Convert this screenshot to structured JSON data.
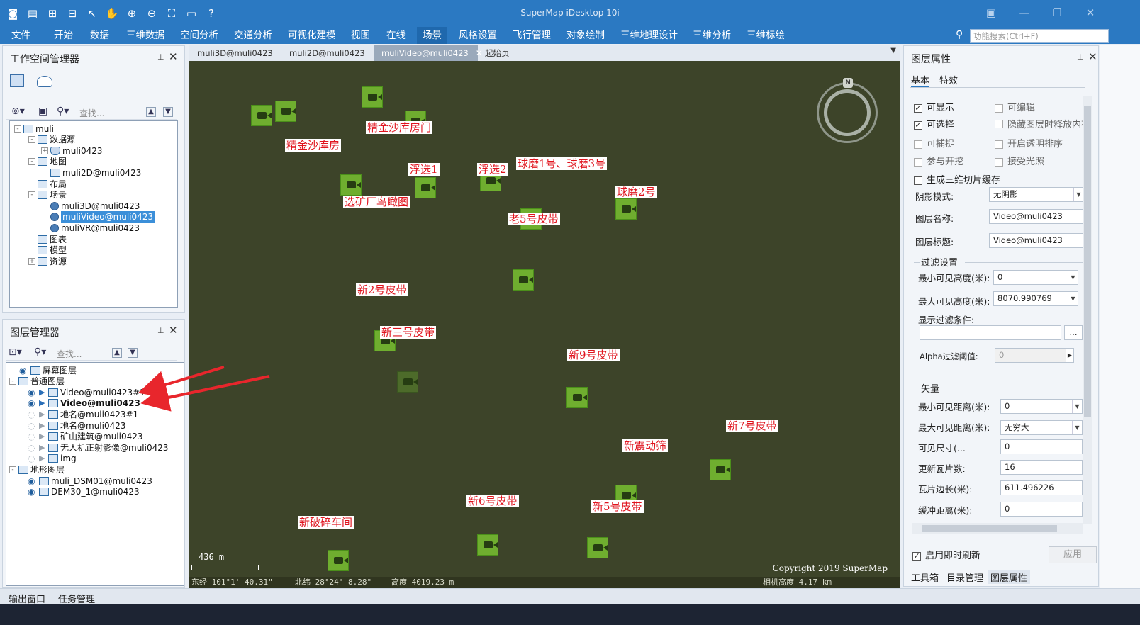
{
  "app": {
    "title": "SuperMap iDesktop 10i",
    "quick_access_icons": [
      "app-logo-icon",
      "save-icon",
      "new-icon",
      "open-icon",
      "select-icon",
      "pan-icon",
      "zoom-in-icon",
      "zoom-out-icon",
      "full-extent-icon",
      "folder-icon",
      "help-icon"
    ],
    "window_buttons": [
      "restore-icon",
      "minimize-icon",
      "maximize-icon",
      "close-icon"
    ]
  },
  "menu": {
    "items": [
      "文件",
      "开始",
      "数据",
      "三维数据",
      "空间分析",
      "交通分析",
      "可视化建模",
      "视图",
      "在线",
      "场景",
      "风格设置",
      "飞行管理",
      "对象绘制",
      "三维地理设计",
      "三维分析",
      "三维标绘"
    ],
    "active": "场景",
    "search_placeholder": "功能搜索(Ctrl+F)"
  },
  "workspace": {
    "title": "工作空间管理器",
    "search_placeholder": "查找...",
    "tree": [
      {
        "label": "muli",
        "icon": "workspace-icon",
        "exp": "-"
      },
      {
        "label": "数据源",
        "icon": "datasource-folder-icon",
        "exp": "-"
      },
      {
        "label": "muli0423",
        "icon": "datasource-icon",
        "exp": "+"
      },
      {
        "label": "地图",
        "icon": "map-folder-icon",
        "exp": "-"
      },
      {
        "label": "muli2D@muli0423",
        "icon": "map-icon",
        "exp": ""
      },
      {
        "label": "布局",
        "icon": "layout-icon",
        "exp": ""
      },
      {
        "label": "场景",
        "icon": "scene-folder-icon",
        "exp": "-"
      },
      {
        "label": "muli3D@muli0423",
        "icon": "scene-icon",
        "exp": ""
      },
      {
        "label": "muliVideo@muli0423",
        "icon": "scene-icon",
        "exp": "",
        "selected": true
      },
      {
        "label": "muliVR@muli0423",
        "icon": "scene-icon",
        "exp": ""
      },
      {
        "label": "图表",
        "icon": "chart-icon",
        "exp": ""
      },
      {
        "label": "模型",
        "icon": "model-icon",
        "exp": ""
      },
      {
        "label": "资源",
        "icon": "resource-icon",
        "exp": "+"
      }
    ]
  },
  "layers": {
    "title": "图层管理器",
    "search_placeholder": "查找...",
    "tree": [
      {
        "label": "屏幕图层",
        "visible": true,
        "exp": ""
      },
      {
        "label": "普通图层",
        "visible": null,
        "exp": "-"
      },
      {
        "label": "Video@muli0423#1",
        "visible": true,
        "exp": ""
      },
      {
        "label": "Video@muli0423",
        "visible": true,
        "exp": "",
        "bold": true
      },
      {
        "label": "地名@muli0423#1",
        "visible": false,
        "exp": ""
      },
      {
        "label": "地名@muli0423",
        "visible": false,
        "exp": ""
      },
      {
        "label": "矿山建筑@muli0423",
        "visible": false,
        "exp": ""
      },
      {
        "label": "无人机正射影像@muli0423",
        "visible": false,
        "exp": ""
      },
      {
        "label": "img",
        "visible": false,
        "exp": ""
      },
      {
        "label": "地形图层",
        "visible": null,
        "exp": "-"
      },
      {
        "label": "muli_DSM01@muli0423",
        "visible": true,
        "exp": ""
      },
      {
        "label": "DEM30_1@muli0423",
        "visible": true,
        "exp": ""
      }
    ]
  },
  "doc_tabs": {
    "tabs": [
      "muli3D@muli0423",
      "muli2D@muli0423",
      "muliVideo@muli0423",
      "起始页"
    ],
    "active": "muliVideo@muli0423"
  },
  "map": {
    "labels": [
      "精金沙库房",
      "精金沙库房门",
      "浮选1",
      "浮选2",
      "球磨1号、球磨3号",
      "球磨2号",
      "选矿厂鸟瞰图",
      "老5号皮带",
      "新2号皮带",
      "新三号皮带",
      "新9号皮带",
      "新7号皮带",
      "新震动筛",
      "新6号皮带",
      "新5号皮带",
      "新破碎车间"
    ],
    "camera_count": 21,
    "compass_label": "N",
    "scale": "436 m",
    "copyright": "Copyright 2019 SuperMap",
    "status": {
      "lon": "东经 101°1' 40.31\"",
      "lat": "北纬 28°24' 8.28\"",
      "height": "高度 4019.23 m",
      "camera_height": "相机高度 4.17 km"
    },
    "colors": {
      "background": "#3d4429",
      "camera": "#6fae2f",
      "label_text": "#e0141e"
    }
  },
  "props": {
    "title": "图层属性",
    "tabs": [
      "基本",
      "特效"
    ],
    "checks": [
      {
        "label": "可显示",
        "checked": true,
        "enabled": true
      },
      {
        "label": "可编辑",
        "checked": false,
        "enabled": false
      },
      {
        "label": "可选择",
        "checked": true,
        "enabled": true
      },
      {
        "label": "隐藏图层时释放内存",
        "checked": false,
        "enabled": false
      },
      {
        "label": "可捕捉",
        "checked": false,
        "enabled": false
      },
      {
        "label": "开启透明排序",
        "checked": false,
        "enabled": false
      },
      {
        "label": "参与开挖",
        "checked": false,
        "enabled": false
      },
      {
        "label": "接受光照",
        "checked": false,
        "enabled": false
      },
      {
        "label": "生成三维切片缓存",
        "checked": false,
        "enabled": true
      }
    ],
    "shadow_mode_label": "阴影模式:",
    "shadow_mode_value": "无阴影",
    "layer_name_label": "图层名称:",
    "layer_name_value": "Video@muli0423",
    "layer_caption_label": "图层标题:",
    "layer_caption_value": "Video@muli0423",
    "filter_group": "过滤设置",
    "min_height_label": "最小可见高度(米):",
    "min_height_value": "0",
    "max_height_label": "最大可见高度(米):",
    "max_height_value": "8070.990769",
    "filter_cond_label": "显示过滤条件:",
    "filter_cond_btn": "...",
    "alpha_label": "Alpha过滤阈值:",
    "alpha_value": "0",
    "vector_group": "矢量",
    "min_dist_label": "最小可见距离(米):",
    "min_dist_value": "0",
    "max_dist_label": "最大可见距离(米):",
    "max_dist_value": "无穷大",
    "visible_size_label": "可见尺寸(...",
    "visible_size_value": "0",
    "update_tiles_label": "更新瓦片数:",
    "update_tiles_value": "16",
    "tile_edge_label": "瓦片边长(米):",
    "tile_edge_value": "611.496226",
    "buffer_label": "缓冲距离(米):",
    "buffer_value": "0",
    "realtime_label": "启用即时刷新",
    "realtime_checked": true,
    "apply_label": "应用",
    "bottom_tabs": [
      "工具箱",
      "目录管理",
      "图层属性"
    ],
    "bottom_active": "图层属性"
  },
  "bottombar": {
    "items": [
      "输出窗口",
      "任务管理"
    ]
  }
}
